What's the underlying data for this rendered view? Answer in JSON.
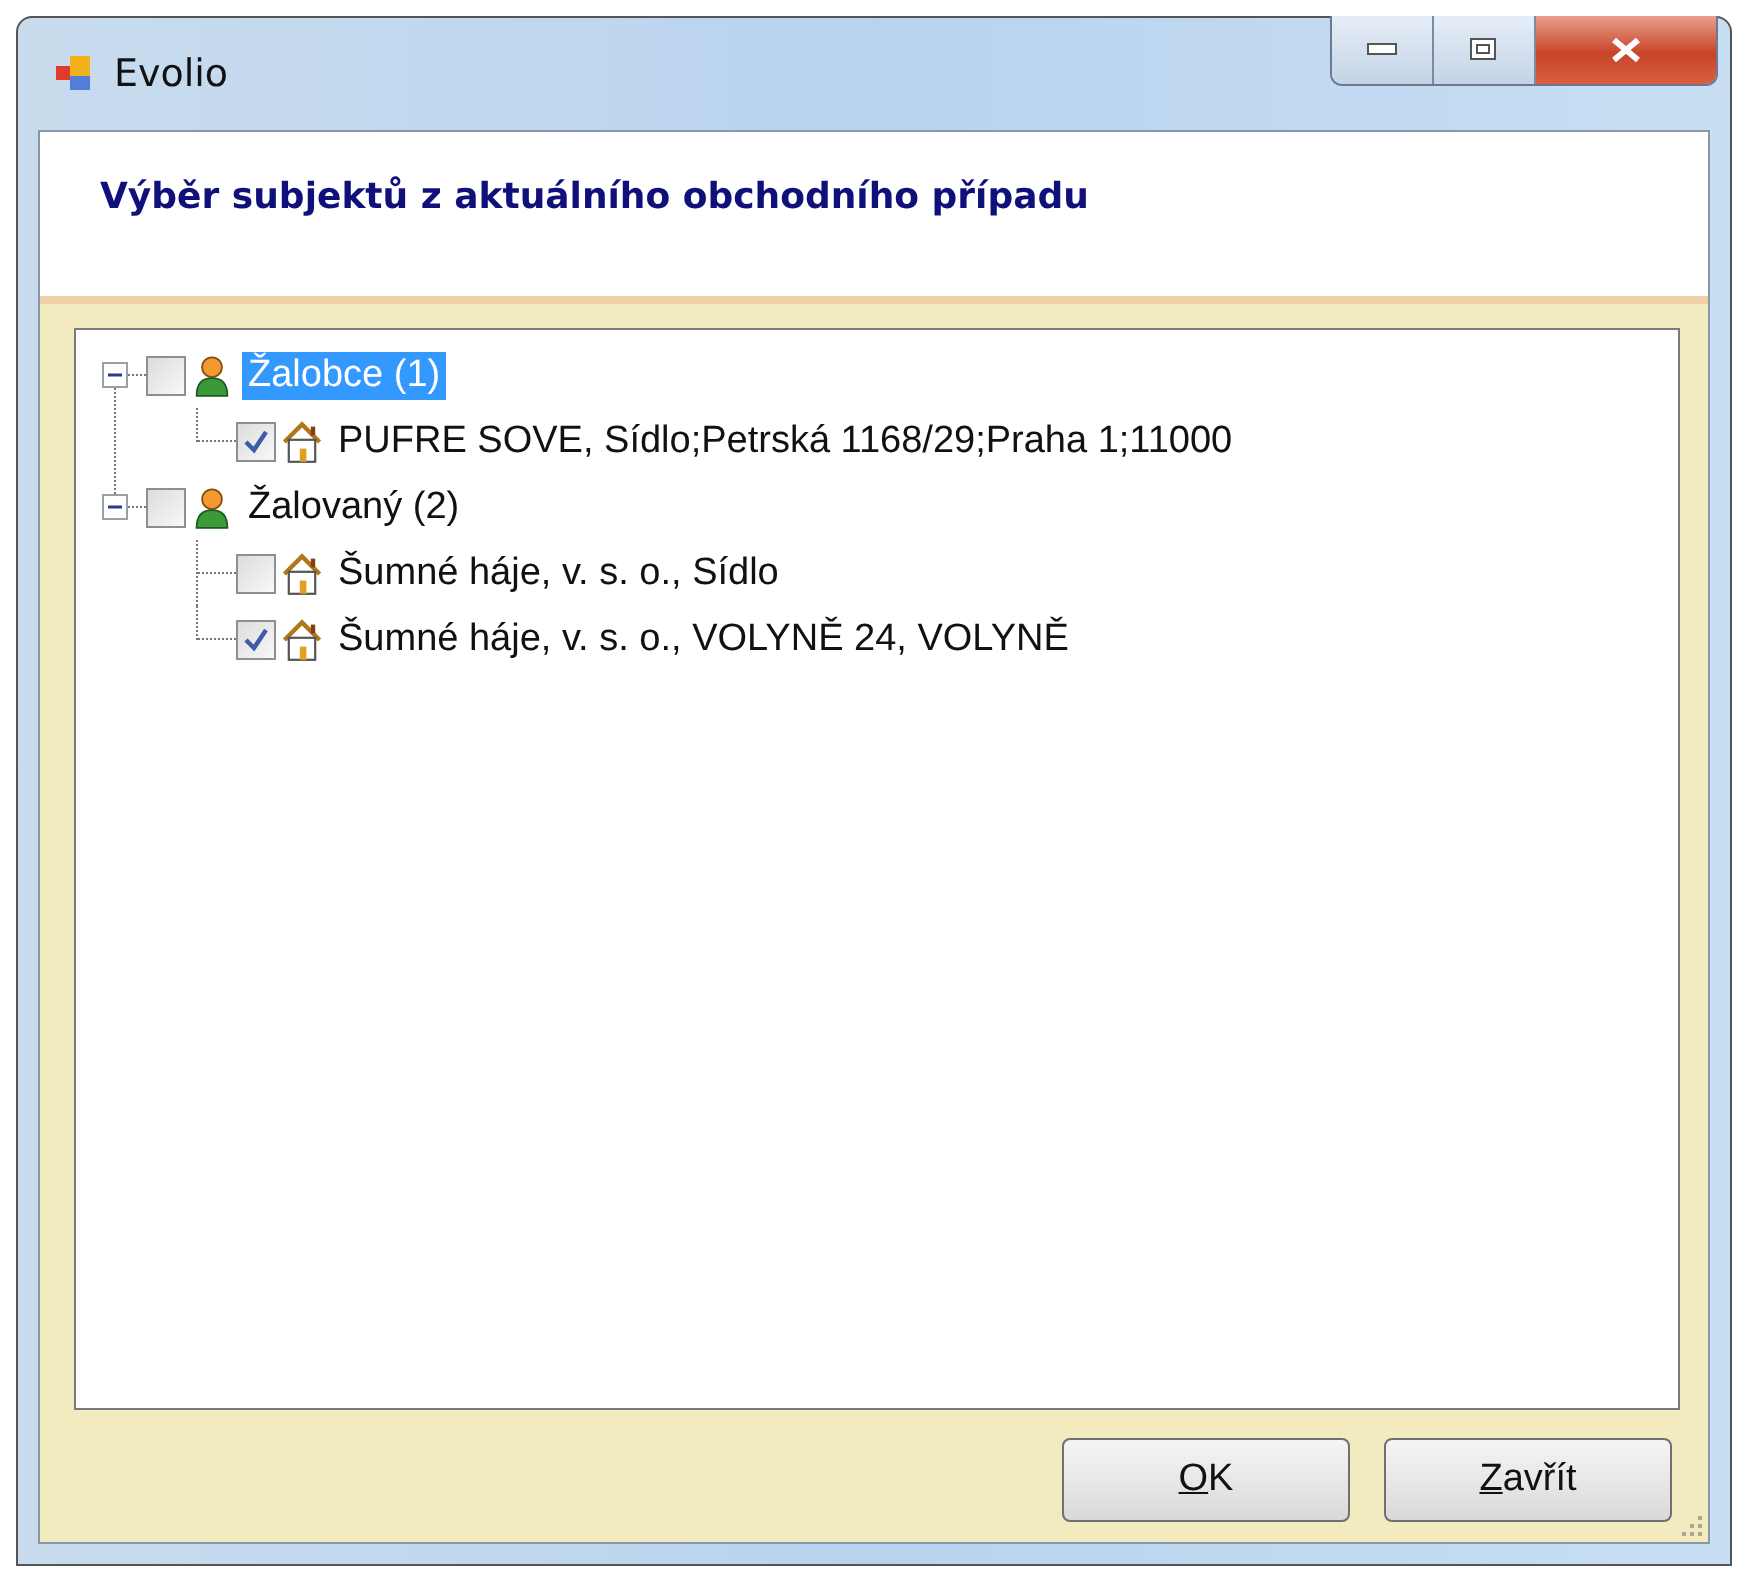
{
  "window": {
    "title": "Evolio"
  },
  "header": {
    "title": "Výběr subjektů z aktuálního obchodního případu"
  },
  "tree": [
    {
      "label": "Žalobce (1)",
      "kind": "person",
      "checked": false,
      "selected": true,
      "expanded": true,
      "children": [
        {
          "label": "PUFRE SOVE, Sídlo;Petrská 1168/29;Praha 1;11000",
          "kind": "house",
          "checked": true,
          "selected": false
        }
      ]
    },
    {
      "label": "Žalovaný (2)",
      "kind": "person",
      "checked": false,
      "selected": false,
      "expanded": true,
      "children": [
        {
          "label": "Šumné háje, v. s. o., Sídlo",
          "kind": "house",
          "checked": false,
          "selected": false
        },
        {
          "label": "Šumné háje, v. s. o., VOLYNĚ  24, VOLYNĚ",
          "kind": "house",
          "checked": true,
          "selected": false
        }
      ]
    }
  ],
  "buttons": [
    {
      "label": "OK"
    },
    {
      "label": "Zavřít"
    }
  ]
}
